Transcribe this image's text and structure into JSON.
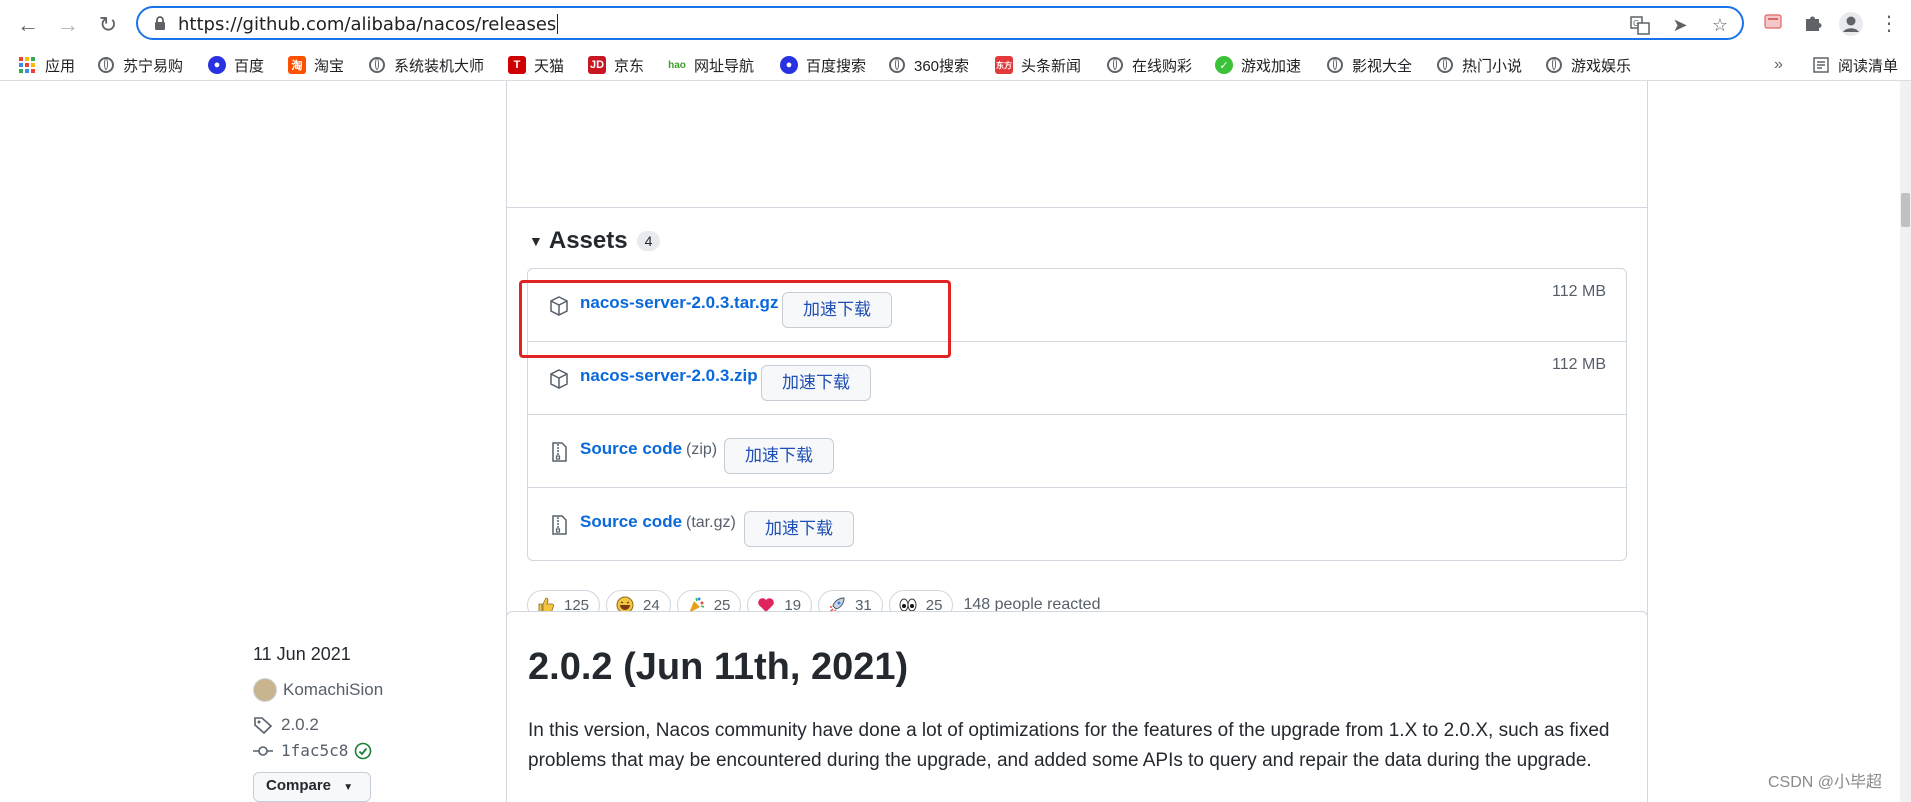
{
  "browser": {
    "url": "https://github.com/alibaba/nacos/releases",
    "bookmarks": [
      "应用",
      "苏宁易购",
      "百度",
      "淘宝",
      "系统装机大师",
      "天猫",
      "京东",
      "网址导航",
      "百度搜索",
      "360搜索",
      "头条新闻",
      "在线购彩",
      "游戏加速",
      "影视大全",
      "热门小说",
      "游戏娱乐"
    ],
    "overflow_label": "»",
    "reading_list": "阅读清单"
  },
  "assets": {
    "title": "Assets",
    "count": "4",
    "items": [
      {
        "name": "nacos-server-2.0.3.tar.gz",
        "sub": "",
        "button": "加速下载",
        "size": "112 MB",
        "icon": "package-icon"
      },
      {
        "name": "nacos-server-2.0.3.zip",
        "sub": "",
        "button": "加速下载",
        "size": "112 MB",
        "icon": "package-icon"
      },
      {
        "name": "Source code",
        "sub": "(zip)",
        "button": "加速下载",
        "size": "",
        "icon": "file-zip-icon"
      },
      {
        "name": "Source code",
        "sub": "(tar.gz)",
        "button": "加速下载",
        "size": "",
        "icon": "file-zip-icon"
      }
    ]
  },
  "reactions": {
    "items": [
      {
        "emoji": "thumbs-up",
        "count": "125"
      },
      {
        "emoji": "laugh",
        "count": "24"
      },
      {
        "emoji": "hooray",
        "count": "25"
      },
      {
        "emoji": "heart",
        "count": "19"
      },
      {
        "emoji": "rocket",
        "count": "31"
      },
      {
        "emoji": "eyes",
        "count": "25"
      }
    ],
    "summary": "148 people reacted"
  },
  "release2": {
    "date": "11 Jun 2021",
    "author": "KomachiSion",
    "tag": "2.0.2",
    "commit": "1fac5c8",
    "compare": "Compare",
    "title": "2.0.2 (Jun 11th, 2021)",
    "body": "In this version, Nacos community have done a lot of optimizations for the features of the upgrade from 1.X to 2.0.X, such as fixed problems that may be encountered during the upgrade, and added some APIs to query and repair the data during the upgrade."
  },
  "watermark": "CSDN @小毕超"
}
